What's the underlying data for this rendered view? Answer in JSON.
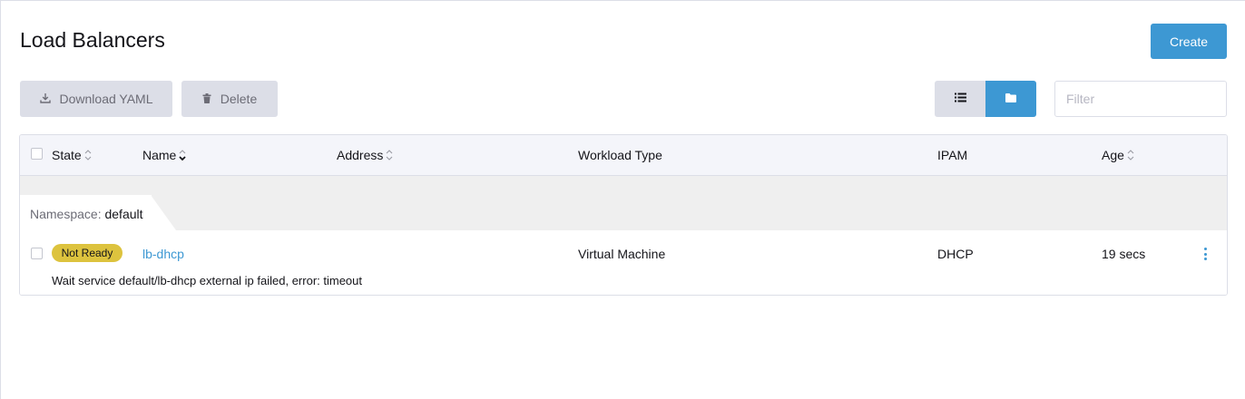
{
  "page": {
    "title": "Load Balancers"
  },
  "actions": {
    "create_label": "Create",
    "download_label": "Download YAML",
    "delete_label": "Delete"
  },
  "filter": {
    "placeholder": "Filter"
  },
  "table": {
    "columns": {
      "state": "State",
      "name": "Name",
      "address": "Address",
      "workload_type": "Workload Type",
      "ipam": "IPAM",
      "age": "Age"
    },
    "sorted_by": "Name",
    "group": {
      "prefix": "Namespace:",
      "value": "default"
    },
    "rows": [
      {
        "state": "Not Ready",
        "name": "lb-dhcp",
        "address": "",
        "workload_type": "Virtual Machine",
        "ipam": "DHCP",
        "age": "19 secs",
        "message": "Wait service default/lb-dhcp external ip failed, error: timeout"
      }
    ]
  },
  "colors": {
    "primary": "#3d98d3",
    "warning_badge": "#ddc33e",
    "secondary_button": "#dcdee7"
  },
  "icons": {
    "download": "download-icon",
    "delete": "trash-icon",
    "list_view": "list-icon",
    "folder_view": "folder-icon",
    "row_actions": "kebab-icon"
  }
}
